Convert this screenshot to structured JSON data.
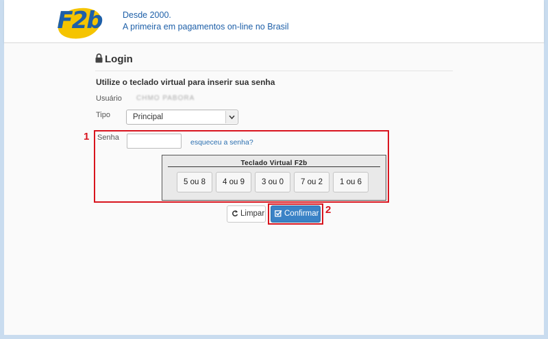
{
  "header": {
    "logo_text": "F2b",
    "tagline_line1": "Desde 2000.",
    "tagline_line2": "A primeira em pagamentos on-line no Brasil"
  },
  "login": {
    "title": "Login",
    "subtitle": "Utilize o teclado virtual para inserir sua senha",
    "usuario_label": "Usuário",
    "usuario_value": "CHMO PABORA",
    "tipo_label": "Tipo",
    "tipo_selected": "Principal",
    "senha_label": "Senha",
    "senha_value": "",
    "forgot_link": "esqueceu a senha?"
  },
  "keyboard": {
    "title": "Teclado Virtual F2b",
    "keys": [
      "5 ou 8",
      "4 ou 9",
      "3 ou 0",
      "7 ou 2",
      "1 ou 6"
    ]
  },
  "actions": {
    "clear_label": "Limpar",
    "confirm_label": "Confirmar"
  },
  "annotations": {
    "badge1": "1",
    "badge2": "2"
  },
  "colors": {
    "brand_blue": "#1d5fa8",
    "brand_yellow": "#f5c400",
    "annotation_red": "#d8131d",
    "primary_button": "#3a82c6"
  }
}
